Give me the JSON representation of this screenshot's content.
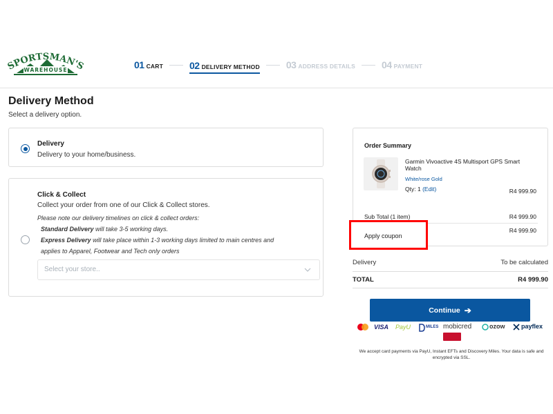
{
  "brand": {
    "logo_top": "SPORTSMAN'S",
    "logo_bottom": "WAREHOUSE"
  },
  "steps": [
    {
      "num": "01",
      "label": "CART",
      "state": "done"
    },
    {
      "num": "02",
      "label": "DELIVERY METHOD",
      "state": "active"
    },
    {
      "num": "03",
      "label": "ADDRESS DETAILS",
      "state": "future"
    },
    {
      "num": "04",
      "label": "PAYMENT",
      "state": "future"
    }
  ],
  "page": {
    "title": "Delivery Method",
    "subtitle": "Select a delivery option."
  },
  "delivery": {
    "title": "Delivery",
    "desc": "Delivery to your home/business.",
    "selected": true
  },
  "collect": {
    "title": "Click & Collect",
    "desc": "Collect your order from one of our Click & Collect stores.",
    "note_intro": "Please note our delivery timelines on click & collect orders:",
    "standard_bold": "Standard Delivery",
    "standard_rest": " will take 3-5 working days.",
    "express_bold": "Express Delivery",
    "express_rest_line1": " will take place within 1-3 working days limited to main centres and",
    "express_rest_line2": "applies to Apparel, Footwear and Tech only orders",
    "store_placeholder": "Select your store..",
    "selected": false
  },
  "summary": {
    "title": "Order Summary",
    "product_name": "Garmin Vivoactive 4S Multisport GPS Smart Watch",
    "variant": "White/rose Gold",
    "qty_label": "Qty: 1",
    "edit_label": "(Edit)",
    "price": "R4 999.90",
    "subtotal_label": "Sub Total (1 item)",
    "subtotal_value": "R4 999.90",
    "coupon_value": "R4 999.90"
  },
  "coupon": {
    "label": "Apply coupon"
  },
  "totals": {
    "delivery_label": "Delivery",
    "delivery_value": "To be calculated",
    "total_label": "TOTAL",
    "total_value": "R4 999.90"
  },
  "continue_label": "Continue",
  "payment_methods": {
    "visa": "VISA",
    "payu": "PayU",
    "miles": "MILES",
    "mobicred": "mobicred",
    "ozow": "ozow",
    "payflex": "payflex"
  },
  "disclaimer": "We accept card payments via PayU, Instant EFTs and Discovery Miles. Your data is safe and encrypted via SSL.",
  "colors": {
    "brand_blue": "#0a57a0",
    "logo_green": "#1e6b35",
    "highlight_red": "#ff0000"
  }
}
